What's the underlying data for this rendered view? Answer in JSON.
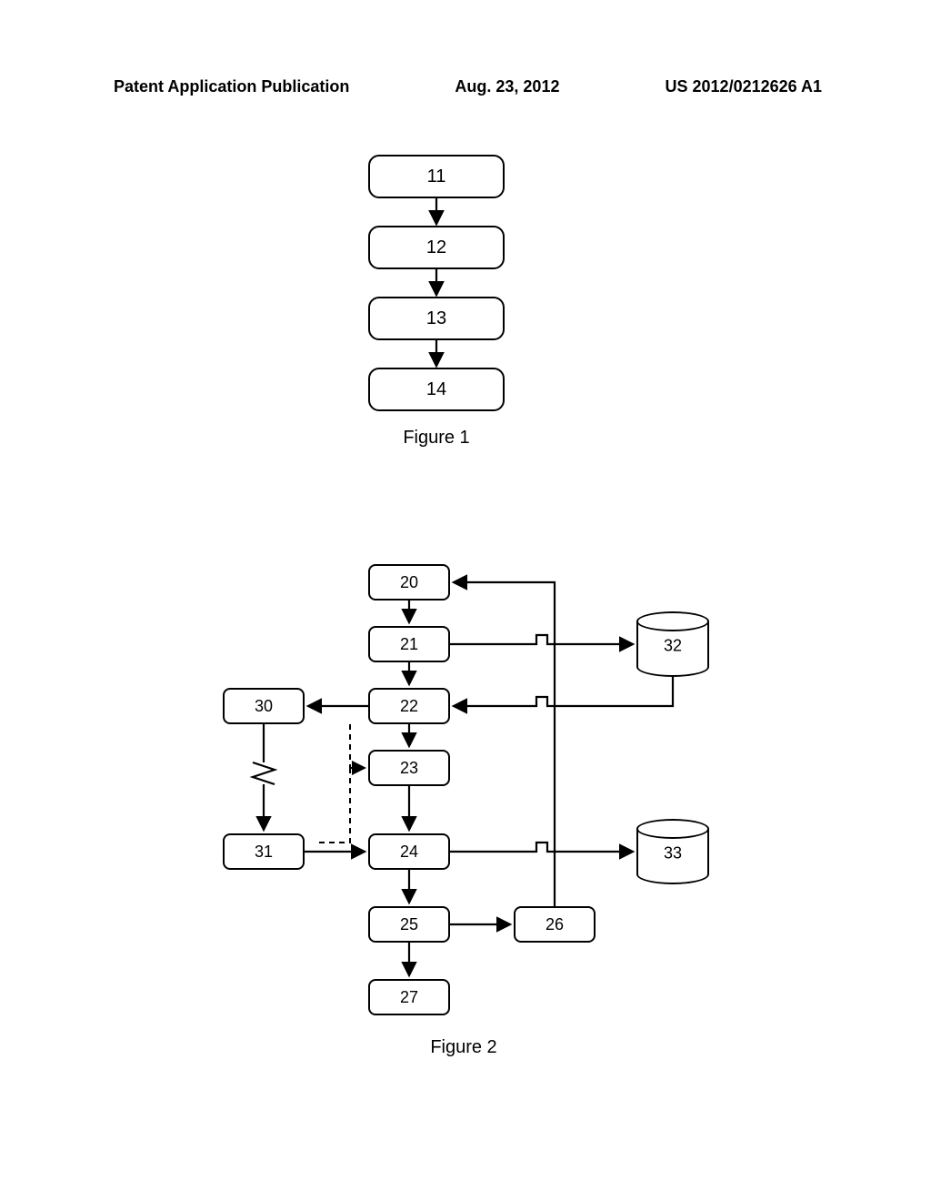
{
  "header": {
    "left": "Patent Application Publication",
    "center": "Aug. 23, 2012",
    "right": "US 2012/0212626 A1"
  },
  "figure1": {
    "boxes": [
      "11",
      "12",
      "13",
      "14"
    ],
    "caption": "Figure 1"
  },
  "figure2": {
    "mainBoxes": [
      "20",
      "21",
      "22",
      "23",
      "24",
      "25",
      "27"
    ],
    "sideBoxes": {
      "left_top": "30",
      "left_bottom": "31",
      "right_mid": "26"
    },
    "cylinders": {
      "top": "32",
      "bottom": "33"
    },
    "caption": "Figure 2"
  }
}
